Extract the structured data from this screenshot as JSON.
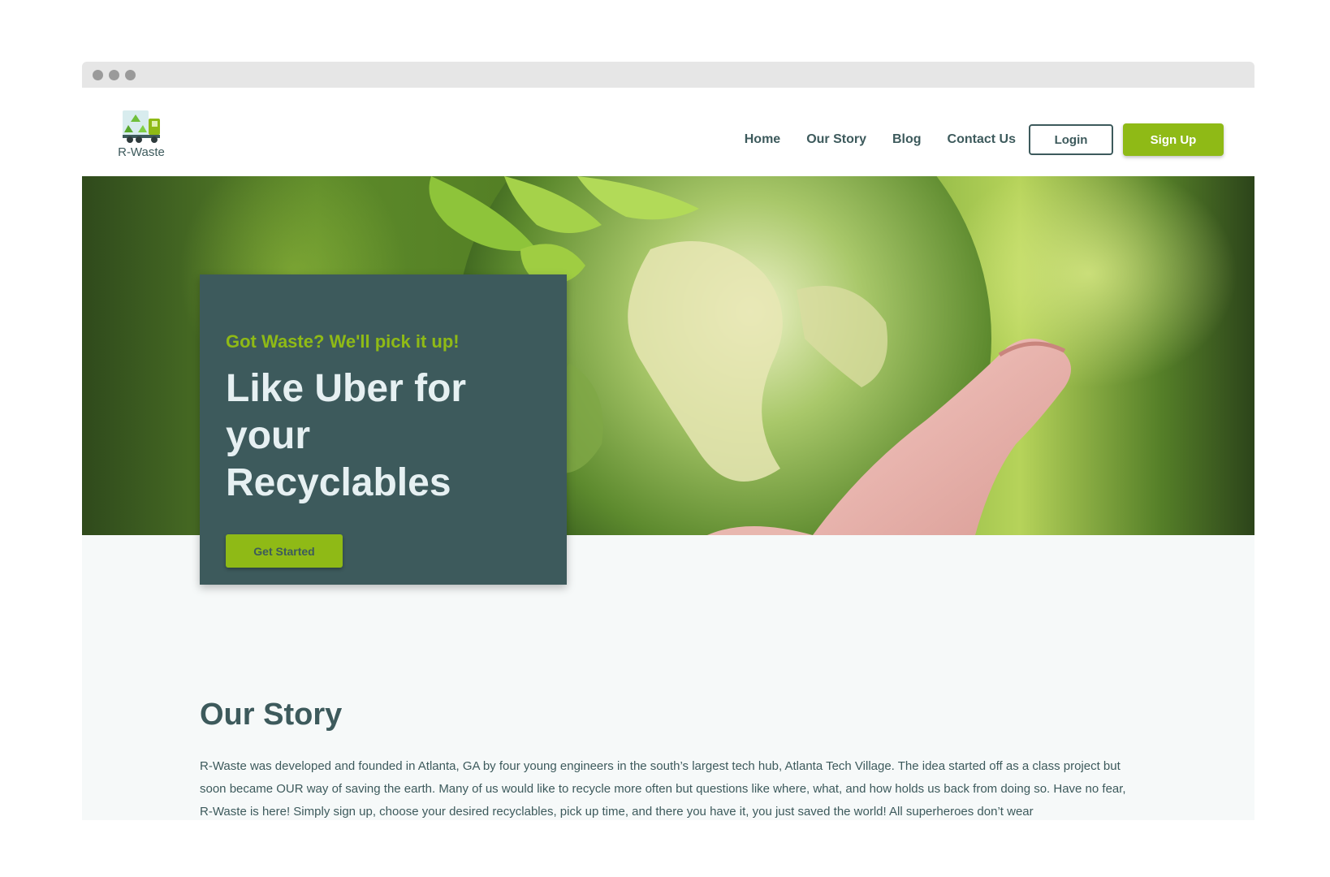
{
  "logo": {
    "text": "R-Waste"
  },
  "nav": {
    "links": [
      "Home",
      "Our Story",
      "Blog",
      "Contact Us"
    ],
    "login_label": "Login",
    "signup_label": "Sign Up"
  },
  "hero": {
    "tagline": "Got Waste? We'll pick it up!",
    "headline": "Like Uber for your Recyclables",
    "cta_label": "Get Started"
  },
  "story": {
    "title": "Our Story",
    "body": "R-Waste was developed and founded in Atlanta, GA by four young engineers in the south’s largest tech hub, Atlanta Tech Village. The idea started off as a class project but soon became OUR way of saving the earth. Many of us would like to recycle more often but questions like where, what, and how holds us back from doing so. Have no fear, R-Waste is here! Simply sign up, choose your desired recyclables, pick up time, and there you have it, you just saved the world! All superheroes don’t wear"
  },
  "colors": {
    "primary_dark": "#3d5a5c",
    "accent_green": "#8fba16",
    "page_bg": "#f6f9f9"
  },
  "icons": {
    "logo": "recycle-truck-icon"
  }
}
